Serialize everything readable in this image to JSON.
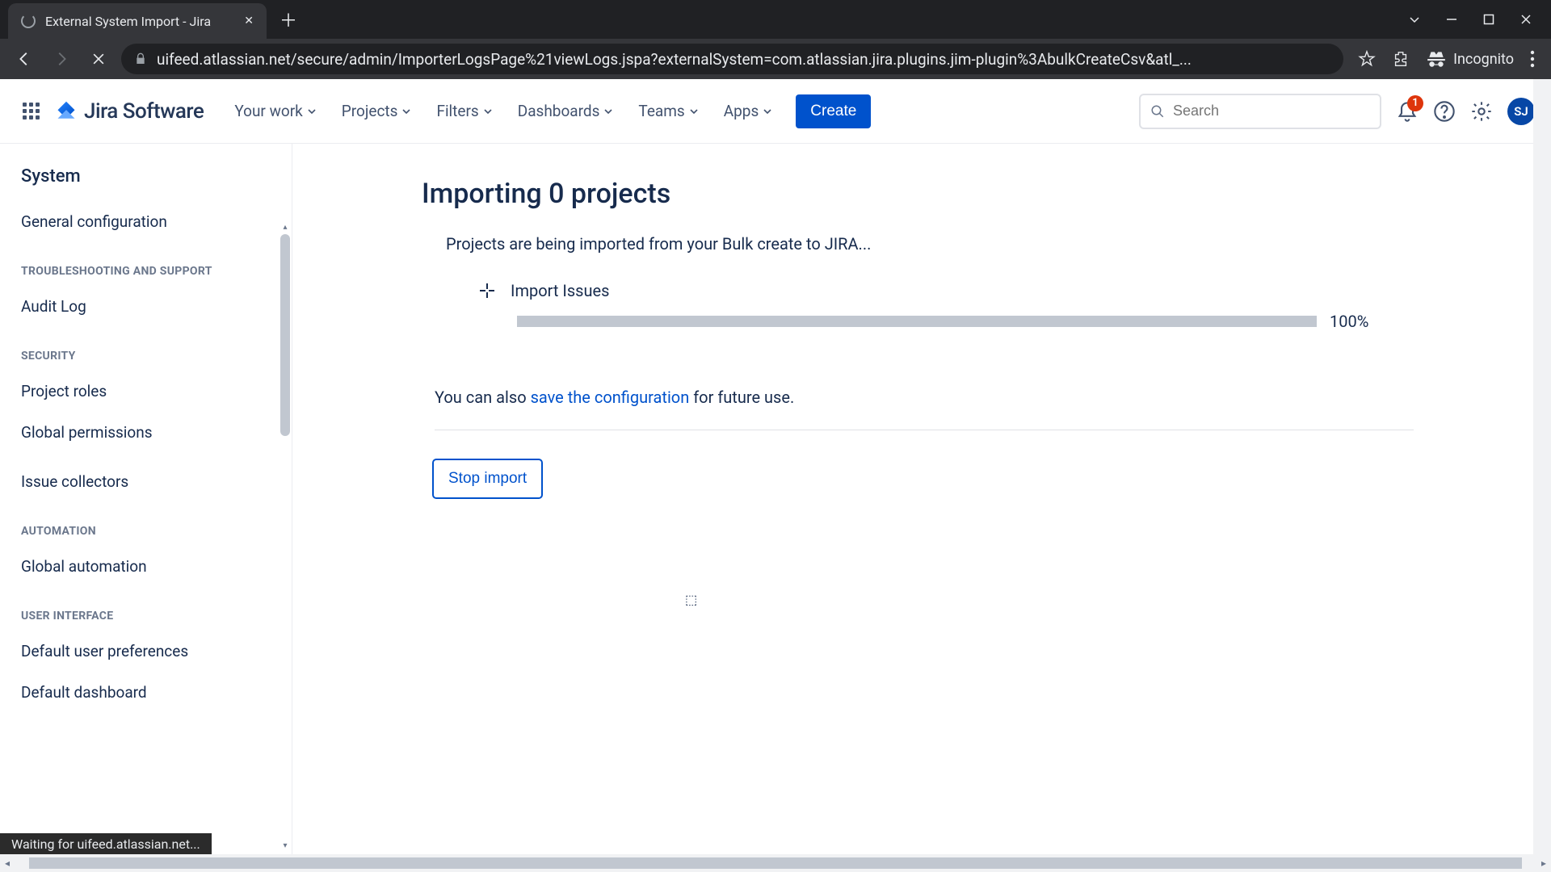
{
  "browser": {
    "tab_title": "External System Import - Jira",
    "url": "uifeed.atlassian.net/secure/admin/ImporterLogsPage%21viewLogs.jspa?externalSystem=com.atlassian.jira.plugins.jim-plugin%3AbulkCreateCsv&atl_...",
    "incognito_label": "Incognito",
    "status_text": "Waiting for uifeed.atlassian.net..."
  },
  "nav": {
    "product": "Jira Software",
    "items": [
      "Your work",
      "Projects",
      "Filters",
      "Dashboards",
      "Teams",
      "Apps"
    ],
    "create": "Create",
    "search_placeholder": "Search",
    "notif_count": "1",
    "avatar_initials": "SJ"
  },
  "sidebar": {
    "heading": "System",
    "groups": [
      {
        "label": "",
        "items": [
          "General configuration"
        ]
      },
      {
        "label": "Troubleshooting and support",
        "items": [
          "Audit Log"
        ]
      },
      {
        "label": "Security",
        "items": [
          "Project roles",
          "Global permissions",
          "Issue collectors"
        ]
      },
      {
        "label": "Automation",
        "items": [
          "Global automation"
        ]
      },
      {
        "label": "User interface",
        "items": [
          "Default user preferences",
          "Default dashboard"
        ]
      }
    ]
  },
  "main": {
    "title": "Importing 0 projects",
    "subtitle": "Projects are being imported from your Bulk create to JIRA...",
    "step_label": "Import Issues",
    "progress_pct": "100%",
    "config_pre": "You can also ",
    "config_link": "save the configuration",
    "config_post": " for future use.",
    "stop_label": "Stop import"
  }
}
